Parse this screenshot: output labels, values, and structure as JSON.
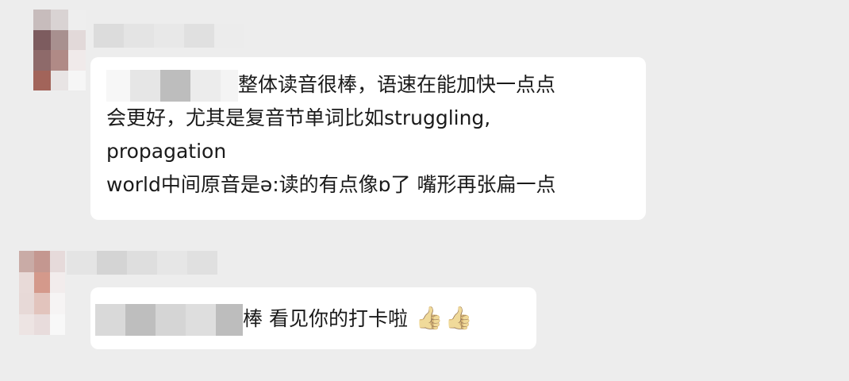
{
  "chat": {
    "messages": [
      {
        "text_line1": "整体读音很棒，语速在能加快一点点",
        "text_line2": "会更好，尤其是复音节单词比如struggling,",
        "text_line3": "propagation",
        "text_line4": "world中间原音是ə:读的有点像ɒ了 嘴形再张扁一点"
      },
      {
        "text": "棒 看见你的打卡啦",
        "emoji_1": "👍",
        "emoji_2": "👍"
      }
    ]
  },
  "colors": {
    "background": "#ededed",
    "bubble": "#ffffff",
    "text": "#1a1a1a"
  }
}
